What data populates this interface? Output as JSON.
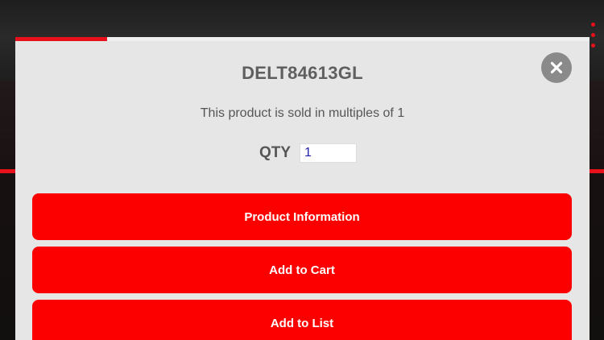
{
  "modal": {
    "title": "DELT84613GL",
    "multiples_text": "This product is sold in multiples of 1",
    "qty_label": "QTY",
    "qty_value": "1",
    "loading_progress": 0.16,
    "close_icon": "close-x-icon",
    "buttons": [
      {
        "label": "Product Information"
      },
      {
        "label": "Add to Cart"
      },
      {
        "label": "Add to List"
      }
    ]
  },
  "colors": {
    "accent": "#fc0000",
    "modal_background": "#e6e6e6",
    "close_button": "#8a8a8a",
    "text_gray": "#555555"
  }
}
